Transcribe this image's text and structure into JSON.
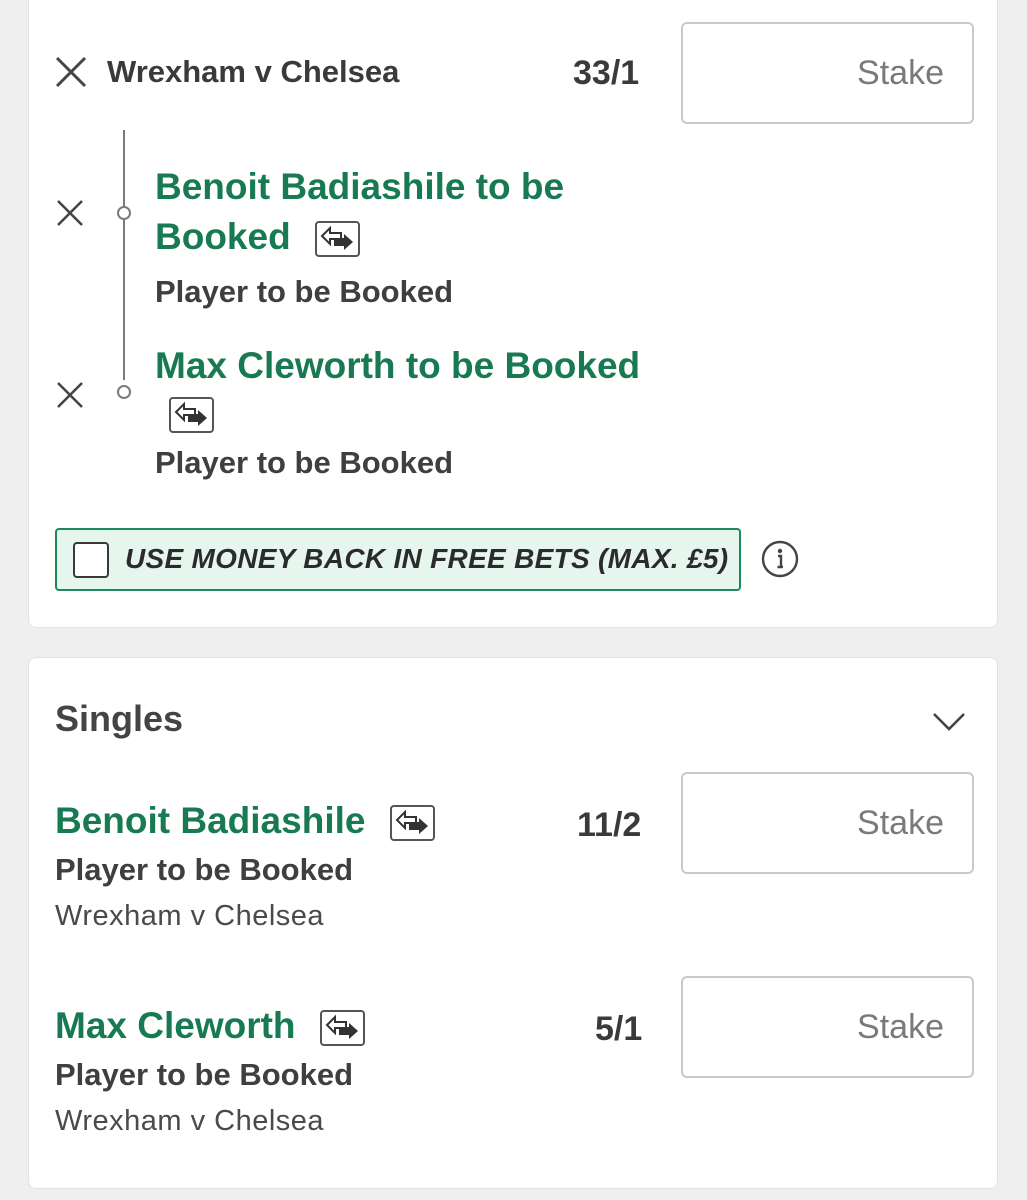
{
  "acca": {
    "match": "Wrexham v Chelsea",
    "odds": "33/1",
    "stake_placeholder": "Stake",
    "selections": [
      {
        "name_line1": "Benoit Badiashile to be",
        "name_line2": "Booked",
        "market": "Player to be Booked"
      },
      {
        "name_line1": "Max Cleworth to be Booked",
        "market": "Player to be Booked"
      }
    ],
    "money_back_label": "USE MONEY BACK IN FREE BETS (MAX. £5)"
  },
  "singles": {
    "title": "Singles",
    "items": [
      {
        "name": "Benoit Badiashile",
        "market": "Player to be Booked",
        "event": "Wrexham v Chelsea",
        "odds": "11/2",
        "stake_placeholder": "Stake"
      },
      {
        "name": "Max Cleworth",
        "market": "Player to be Booked",
        "event": "Wrexham v Chelsea",
        "odds": "5/1",
        "stake_placeholder": "Stake"
      }
    ]
  },
  "colors": {
    "brand_green": "#177a52",
    "money_back_bg": "#e6f6ef",
    "money_back_border": "#1c8a5b"
  },
  "icons": [
    "close-icon",
    "swap-icon",
    "info-icon",
    "chevron-down-icon"
  ]
}
